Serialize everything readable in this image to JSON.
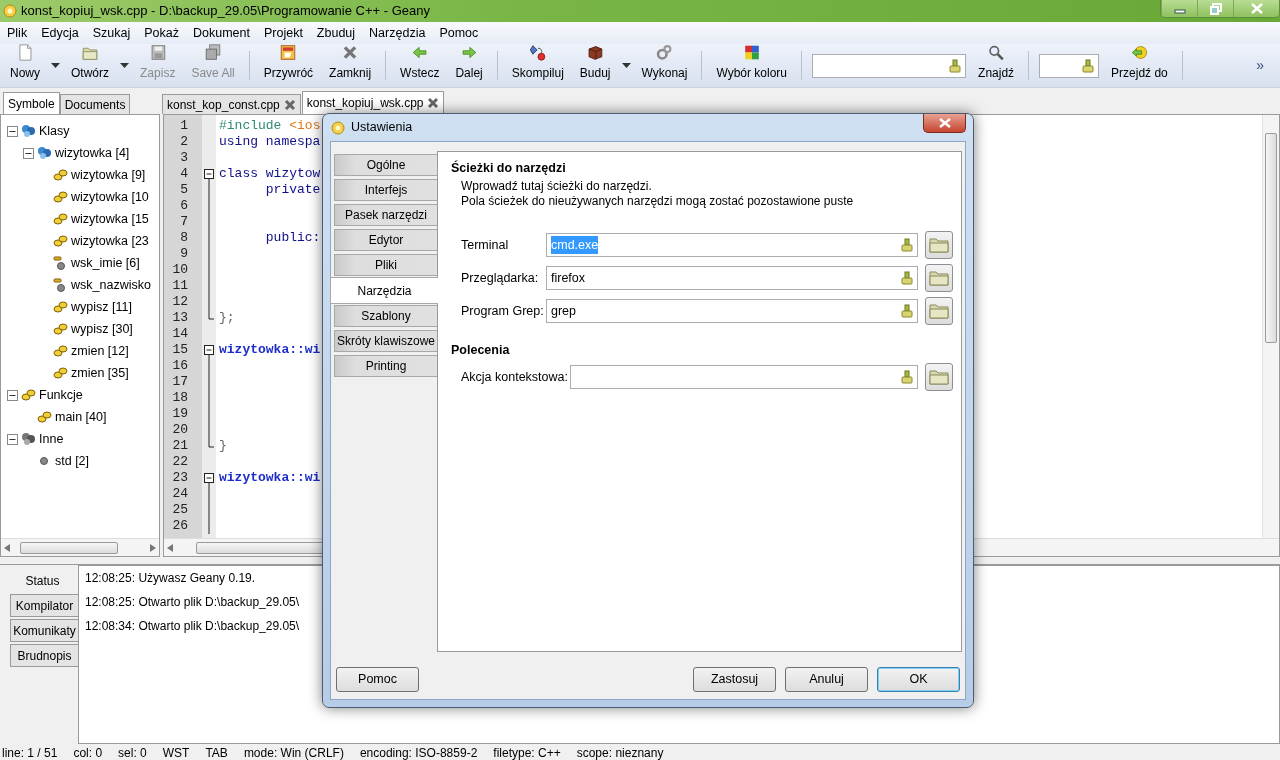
{
  "window": {
    "title": "konst_kopiuj_wsk.cpp - D:\\backup_29.05\\Programowanie C++ - Geany"
  },
  "menu": [
    "Plik",
    "Edycja",
    "Szukaj",
    "Pokaż",
    "Dokument",
    "Projekt",
    "Zbuduj",
    "Narzędzia",
    "Pomoc"
  ],
  "toolbar": [
    {
      "kind": "button",
      "label": "Nowy",
      "disabled": false
    },
    {
      "kind": "dropdown"
    },
    {
      "kind": "button",
      "label": "Otwórz",
      "disabled": false
    },
    {
      "kind": "dropdown"
    },
    {
      "kind": "button",
      "label": "Zapisz",
      "disabled": true
    },
    {
      "kind": "button",
      "label": "Save All",
      "disabled": true
    },
    {
      "kind": "separator"
    },
    {
      "kind": "button",
      "label": "Przywróć",
      "disabled": false
    },
    {
      "kind": "button",
      "label": "Zamknij",
      "disabled": false
    },
    {
      "kind": "separator"
    },
    {
      "kind": "button",
      "label": "Wstecz",
      "disabled": false
    },
    {
      "kind": "button",
      "label": "Dalej",
      "disabled": false
    },
    {
      "kind": "separator"
    },
    {
      "kind": "button",
      "label": "Skompiluj",
      "disabled": false
    },
    {
      "kind": "button",
      "label": "Buduj",
      "disabled": false
    },
    {
      "kind": "dropdown"
    },
    {
      "kind": "button",
      "label": "Wykonaj",
      "disabled": false
    },
    {
      "kind": "separator"
    },
    {
      "kind": "button",
      "label": "Wybór koloru",
      "disabled": false
    },
    {
      "kind": "separator"
    },
    {
      "kind": "search_field"
    },
    {
      "kind": "button",
      "label": "Znajdź",
      "disabled": false
    },
    {
      "kind": "separator"
    },
    {
      "kind": "goto_field"
    },
    {
      "kind": "button",
      "label": "Przejdź do",
      "disabled": false
    },
    {
      "kind": "separator"
    },
    {
      "kind": "overflow",
      "label": "»"
    }
  ],
  "sidebar": {
    "tabs": [
      {
        "label": "Symbole",
        "selected": true
      },
      {
        "label": "Documents",
        "selected": false
      }
    ],
    "tree": [
      {
        "label": "Klasy",
        "kind": "group",
        "expanded": true,
        "children": [
          {
            "label": "wizytowka [4]",
            "kind": "class",
            "expanded": true,
            "children": [
              {
                "label": "wizytowka [9]",
                "kind": "method"
              },
              {
                "label": "wizytowka [10",
                "kind": "method"
              },
              {
                "label": "wizytowka [15",
                "kind": "method"
              },
              {
                "label": "wizytowka [23",
                "kind": "method"
              },
              {
                "label": "wsk_imie [6]",
                "kind": "field"
              },
              {
                "label": "wsk_nazwisko",
                "kind": "field"
              },
              {
                "label": "wypisz [11]",
                "kind": "method"
              },
              {
                "label": "wypisz [30]",
                "kind": "method"
              },
              {
                "label": "zmien [12]",
                "kind": "method"
              },
              {
                "label": "zmien [35]",
                "kind": "method"
              }
            ]
          }
        ]
      },
      {
        "label": "Funkcje",
        "kind": "functions",
        "expanded": true,
        "children": [
          {
            "label": "main [40]",
            "kind": "method"
          }
        ]
      },
      {
        "label": "Inne",
        "kind": "other",
        "expanded": true,
        "children": [
          {
            "label": "std [2]",
            "kind": "namespace"
          }
        ]
      }
    ]
  },
  "editor": {
    "tabs": [
      {
        "label": "konst_kop_const.cpp",
        "selected": false
      },
      {
        "label": "konst_kopiuj_wsk.cpp",
        "selected": true
      }
    ],
    "lines": [
      {
        "number": "1",
        "kind": "plain",
        "tokens": [
          {
            "text": "#include",
            "kind": "preproc"
          },
          {
            "text": " <ios",
            "kind": "string"
          }
        ]
      },
      {
        "number": "2",
        "kind": "plain",
        "tokens": [
          {
            "text": "using namespa",
            "kind": "keyword"
          }
        ]
      },
      {
        "number": "3",
        "kind": "plain"
      },
      {
        "number": "4",
        "kind": "fold_start",
        "tokens": [
          {
            "text": "class wizytow",
            "kind": "keyword"
          }
        ]
      },
      {
        "number": "5",
        "kind": "fold_body",
        "tokens": [
          {
            "text": "      private",
            "kind": "keyword"
          }
        ]
      },
      {
        "number": "6",
        "kind": "fold_body"
      },
      {
        "number": "7",
        "kind": "fold_body"
      },
      {
        "number": "8",
        "kind": "fold_body",
        "tokens": [
          {
            "text": "      public:",
            "kind": "keyword"
          }
        ]
      },
      {
        "number": "9",
        "kind": "fold_body"
      },
      {
        "number": "10",
        "kind": "fold_body"
      },
      {
        "number": "11",
        "kind": "fold_body"
      },
      {
        "number": "12",
        "kind": "fold_body"
      },
      {
        "number": "13",
        "kind": "fold_end",
        "tokens": [
          {
            "text": "};",
            "kind": "plain"
          }
        ]
      },
      {
        "number": "14",
        "kind": "plain"
      },
      {
        "number": "15",
        "kind": "fold_start",
        "tokens": [
          {
            "text": "wizytowka::wi",
            "kind": "identifier"
          }
        ]
      },
      {
        "number": "16",
        "kind": "fold_body"
      },
      {
        "number": "17",
        "kind": "fold_body"
      },
      {
        "number": "18",
        "kind": "fold_body"
      },
      {
        "number": "19",
        "kind": "fold_body"
      },
      {
        "number": "20",
        "kind": "fold_body"
      },
      {
        "number": "21",
        "kind": "fold_end",
        "tokens": [
          {
            "text": "}",
            "kind": "plain"
          }
        ]
      },
      {
        "number": "22",
        "kind": "plain"
      },
      {
        "number": "23",
        "kind": "fold_start",
        "tokens": [
          {
            "text": "wizytowka::wi",
            "kind": "identifier"
          }
        ]
      },
      {
        "number": "24",
        "kind": "fold_body"
      },
      {
        "number": "25",
        "kind": "fold_body"
      },
      {
        "number": "26",
        "kind": "fold_body"
      }
    ]
  },
  "messages": {
    "tabs": [
      {
        "label": "Status",
        "selected": true
      },
      {
        "label": "Kompilator",
        "selected": false
      },
      {
        "label": "Komunikaty",
        "selected": false
      },
      {
        "label": "Brudnopis",
        "selected": false
      }
    ],
    "lines": [
      "12:08:25: Używasz Geany 0.19.",
      "12:08:25: Otwarto plik D:\\backup_29.05\\",
      "12:08:34: Otwarto plik D:\\backup_29.05\\"
    ]
  },
  "status_bar": [
    "line: 1 / 51",
    "col: 0",
    "sel: 0",
    "WST",
    "TAB",
    "mode: Win (CRLF)",
    "encoding: ISO-8859-2",
    "filetype: C++",
    "scope: nieznany"
  ],
  "dialog": {
    "title": "Ustawienia",
    "tabs": [
      {
        "label": "Ogólne",
        "selected": false
      },
      {
        "label": "Interfejs",
        "selected": false
      },
      {
        "label": "Pasek narzędzi",
        "selected": false
      },
      {
        "label": "Edytor",
        "selected": false
      },
      {
        "label": "Pliki",
        "selected": false
      },
      {
        "label": "Narzędzia",
        "selected": true
      },
      {
        "label": "Szablony",
        "selected": false
      },
      {
        "label": "Skróty klawiszowe",
        "selected": false
      },
      {
        "label": "Printing",
        "selected": false
      }
    ],
    "sections": [
      {
        "heading": "Ścieżki do narzędzi",
        "description": [
          "Wprowadź tutaj ścieżki do narzędzi.",
          "Pola ścieżek do nieużywanych narzędzi mogą zostać pozostawione puste"
        ],
        "fields": [
          {
            "label": "Terminal",
            "value": "cmd.exe",
            "text_selected": true
          },
          {
            "label": "Przeglądarka:",
            "value": "firefox",
            "text_selected": false
          },
          {
            "label": "Program Grep:",
            "value": "grep",
            "text_selected": false
          }
        ]
      },
      {
        "heading": "Polecenia",
        "fields": [
          {
            "label": "Akcja kontekstowa:"
          }
        ]
      }
    ],
    "help_button": {
      "label": "Pomoc"
    },
    "buttons": [
      {
        "label": "Zastosuj",
        "default": false
      },
      {
        "label": "Anuluj",
        "default": false
      },
      {
        "label": "OK",
        "default": true
      }
    ]
  }
}
